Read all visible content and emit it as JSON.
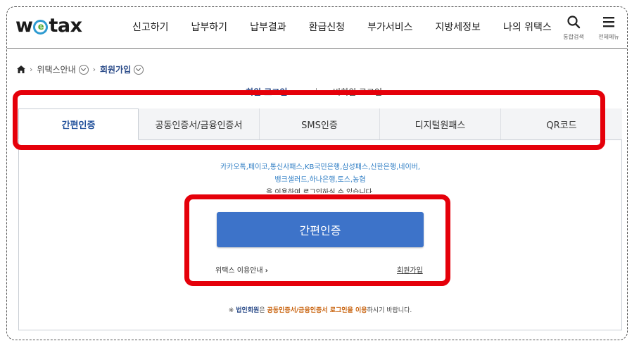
{
  "header": {
    "logo_pre": "w",
    "logo_mark": "e",
    "logo_post": "tax",
    "nav": [
      "신고하기",
      "납부하기",
      "납부결과",
      "환급신청",
      "부가서비스",
      "지방세정보",
      "나의 위택스"
    ],
    "search_label": "통합검색",
    "menu_label": "전체메뉴"
  },
  "breadcrumb": {
    "level1": "위택스안내",
    "current": "회원가입"
  },
  "login_type": {
    "member": "회원 로그인",
    "guest": "비회원 로그인"
  },
  "tabs": [
    "간편인증",
    "공동인증서/금융인증서",
    "SMS인증",
    "디지털원패스",
    "QR코드"
  ],
  "panel": {
    "desc_line1": "카카오톡,페이코,통신사패스,KB국민은행,삼성패스,신한은행,네이버,",
    "desc_line2": "뱅크샐러드,하나은행,토스,농협",
    "desc_line3": "을 이용하여 로그인하실 수 있습니다.",
    "button_label": "간편인증",
    "help_link": "위택스 이용안내",
    "join_link": "회원가입",
    "notice_prefix": "※",
    "notice_em1": "법인회원",
    "notice_mid": "은",
    "notice_em2": "공동인증서/금융인증서 로그인을 이용",
    "notice_suffix": "하시기 바랍니다."
  },
  "colors": {
    "accent": "#3d73c9",
    "brand_blue": "#2d4d8a",
    "annotation_red": "#e5000a",
    "notice_orange": "#c8600a"
  }
}
